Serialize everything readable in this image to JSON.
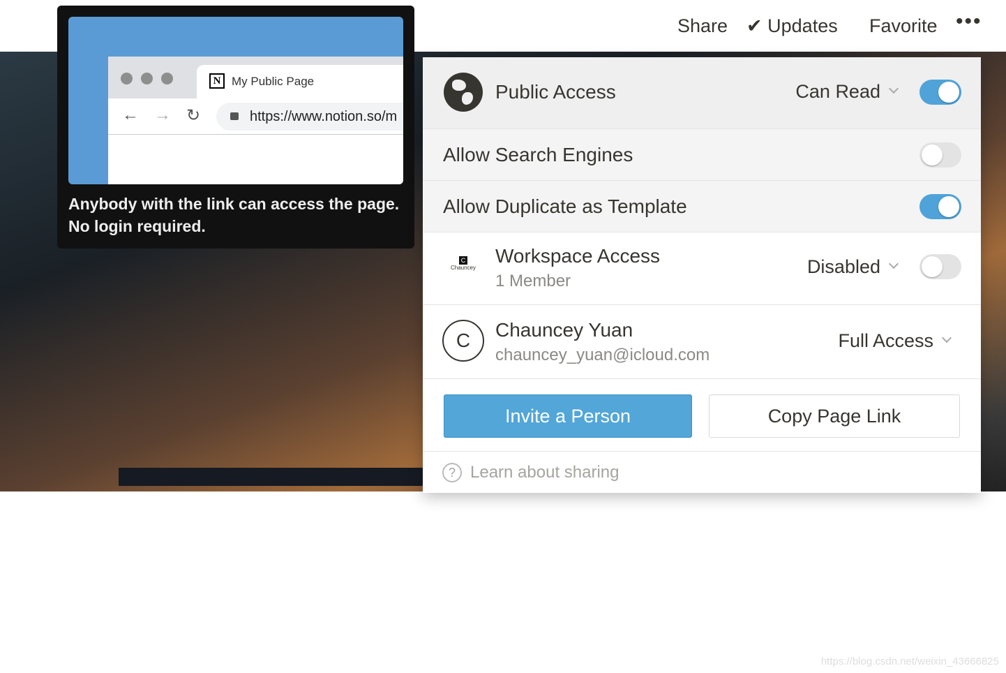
{
  "topbar": {
    "share": "Share",
    "updates": "Updates",
    "favorite": "Favorite"
  },
  "tooltip": {
    "tab_title": "My Public Page",
    "url": "https://www.notion.so/m",
    "text_line1": "Anybody with the link can access the page.",
    "text_line2": "No login required."
  },
  "popup": {
    "public_access": {
      "label": "Public Access",
      "permission": "Can Read",
      "enabled": true
    },
    "allow_search_engines": {
      "label": "Allow Search Engines",
      "enabled": false
    },
    "allow_duplicate": {
      "label": "Allow Duplicate as Template",
      "enabled": true
    },
    "workspace_access": {
      "label": "Workspace Access",
      "members": "1 Member",
      "permission": "Disabled",
      "enabled": false,
      "logo_text": "Chauncey"
    },
    "user": {
      "initial": "C",
      "name": "Chauncey Yuan",
      "email": "chauncey_yuan@icloud.com",
      "permission": "Full Access"
    },
    "invite_button": "Invite a Person",
    "copy_link_button": "Copy Page Link",
    "learn": "Learn about sharing"
  },
  "colors": {
    "accent": "#4fa3d8",
    "button": "#52a6d8"
  },
  "watermark": "https://blog.csdn.net/weixin_43666825"
}
